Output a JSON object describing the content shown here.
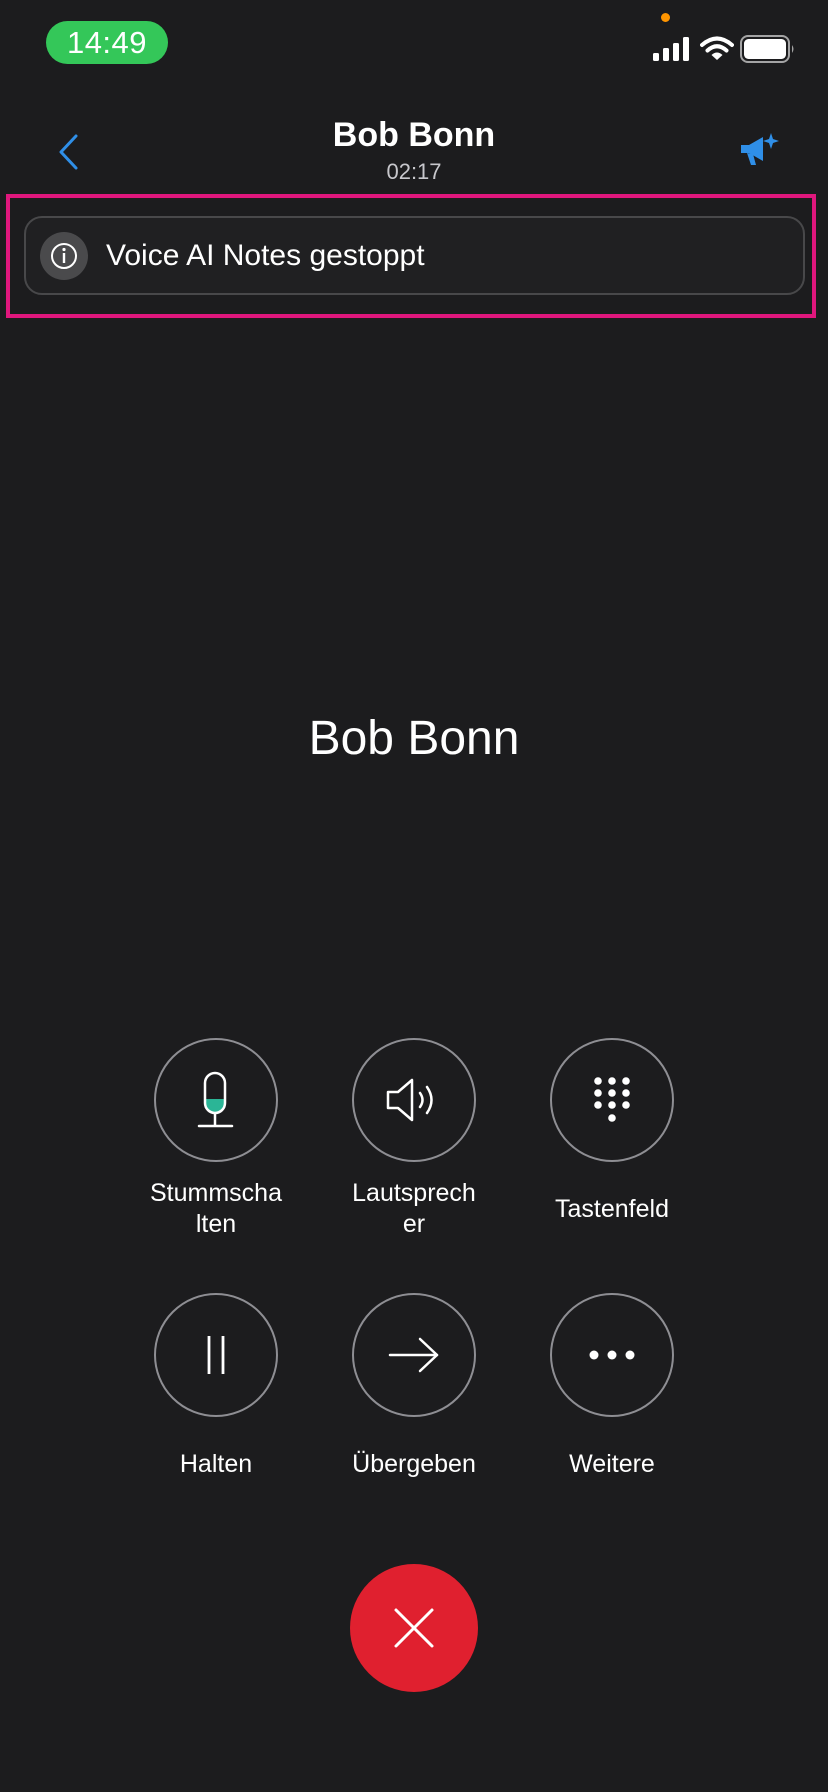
{
  "status_bar": {
    "time": "14:49",
    "icons": [
      "signal-icon",
      "wifi-icon",
      "battery-icon"
    ]
  },
  "header": {
    "title": "Bob Bonn",
    "duration": "02:17",
    "back_icon": "chevron-left-icon",
    "ai_icon": "megaphone-sparkle-icon"
  },
  "banner": {
    "icon": "info-icon",
    "text": "Voice AI Notes gestoppt"
  },
  "callee": {
    "name": "Bob Bonn"
  },
  "actions": [
    {
      "label": "Stummscha\nlten",
      "icon": "microphone-icon"
    },
    {
      "label": "Lautsprech\ner",
      "icon": "speaker-icon"
    },
    {
      "label": "Tastenfeld",
      "icon": "keypad-icon"
    },
    {
      "label": "Halten",
      "icon": "pause-icon"
    },
    {
      "label": "Übergeben",
      "icon": "arrow-right-icon"
    },
    {
      "label": "Weitere",
      "icon": "more-icon"
    }
  ],
  "end_call": {
    "icon": "close-icon"
  },
  "colors": {
    "background": "#1c1c1e",
    "accent_blue": "#2f8fe8",
    "time_pill": "#34c759",
    "highlight": "#e0177d",
    "end_call": "#e0202f",
    "mic_level": "#2bb596"
  }
}
